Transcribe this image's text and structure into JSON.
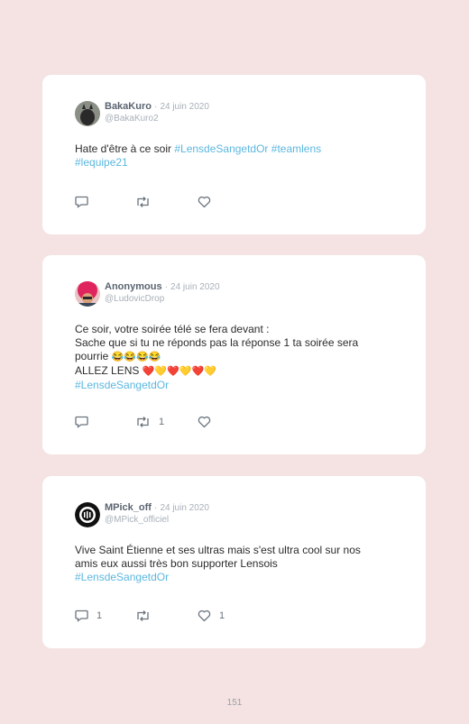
{
  "page_number": "151",
  "icons": {
    "reply": "speech-bubble-icon",
    "retweet": "retweet-arrows-icon",
    "like": "heart-icon"
  },
  "colors": {
    "background": "#f5e3e3",
    "hashtag": "#5cb7e0",
    "name": "#5a6470",
    "muted": "#a8b0b8"
  },
  "tweets": [
    {
      "name": "BakaKuro",
      "date": "24 juin 2020",
      "handle": "@BakaKuro2",
      "text_1": "Hate d'être à ce soir ",
      "tag_1": "#LensdeSangetdOr",
      "tag_2": "#teamlens",
      "tag_3": "#lequipe21",
      "reply_count": "",
      "retweet_count": "",
      "like_count": ""
    },
    {
      "name": "Anonymous",
      "date": "24 juin 2020",
      "handle": "@LudovicDrop",
      "line_1": "Ce soir, votre soirée télé se fera devant :",
      "line_2": "Sache que si tu ne réponds pas la réponse 1 ta soirée sera",
      "line_3": "pourrie",
      "line_3_emoji": "😂😂😂😂",
      "line_4": "ALLEZ LENS",
      "line_4_emoji": "❤️💛❤️💛❤️💛",
      "tag_1": "#LensdeSangetdOr",
      "reply_count": "",
      "retweet_count": "1",
      "like_count": ""
    },
    {
      "name": "MPick_off",
      "date": "24 juin 2020",
      "handle": "@MPick_officiel",
      "line_1": "Vive Saint Étienne et ses ultras mais s'est ultra cool sur nos",
      "line_2": "amis eux aussi très bon supporter Lensois",
      "tag_1": "#LensdeSangetdOr",
      "reply_count": "1",
      "retweet_count": "",
      "like_count": "1"
    }
  ]
}
